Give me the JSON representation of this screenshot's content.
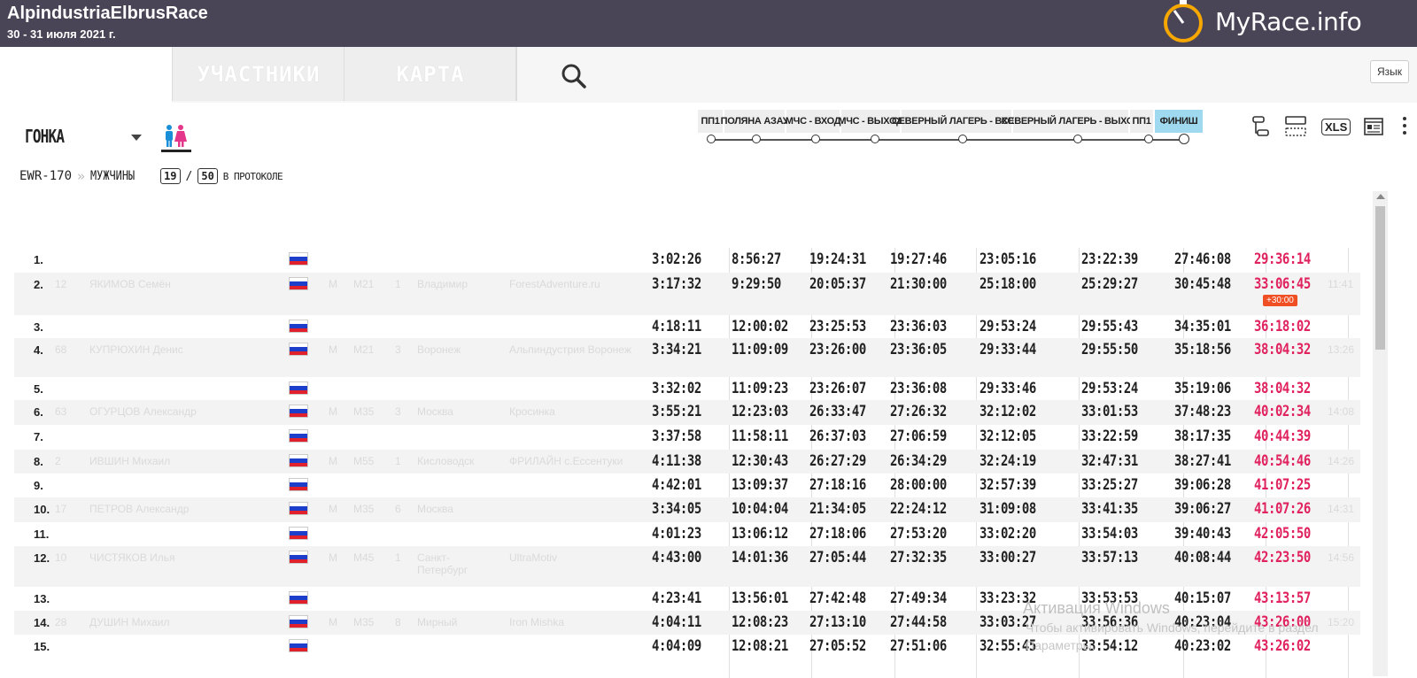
{
  "header": {
    "title": "AlpindustriaElbrusRace",
    "dates": "30 - 31 июля 2021 г.",
    "brand": "MyRace.info"
  },
  "nav": {
    "tabs": [
      {
        "label": "УЧАСТНИКИ"
      },
      {
        "label": "КАРТА"
      }
    ],
    "search_icon": "search-icon",
    "lang_label": "Язык"
  },
  "filters": {
    "race_label": "ГОНКА",
    "gender_icon": "gender-icon"
  },
  "breadcrumb": {
    "distance": "EWR-170",
    "separator": "»",
    "category": "МУЖЧИНЫ",
    "shown": "19",
    "slash": "/",
    "total": "50",
    "suffix": "В ПРОТОКОЛЕ"
  },
  "checkpoints": [
    {
      "label": "ПП1",
      "active": false
    },
    {
      "label": "ПОЛЯНА АЗАУ",
      "active": false
    },
    {
      "label": "МЧС - ВХОД",
      "active": false
    },
    {
      "label": "МЧС - ВЫХОД",
      "active": false
    },
    {
      "label": "СЕВЕРНЫЙ ЛАГЕРЬ - ВХОД",
      "active": false
    },
    {
      "label": "СЕВЕРНЫЙ ЛАГЕРЬ - ВЫХОД",
      "active": false
    },
    {
      "label": "ПП1",
      "active": false
    },
    {
      "label": "ФИНИШ",
      "active": true
    }
  ],
  "tools": {
    "xls_label": "XLS"
  },
  "flag_colors": [
    "#ffffff",
    "#1c3ecb",
    "#e0202a"
  ],
  "results": [
    {
      "place": "1.",
      "bib": "",
      "name": "",
      "sex": "",
      "group": "",
      "gplace": "",
      "city": "",
      "team": "",
      "times": [
        "3:02:26",
        "8:56:27",
        "19:24:31",
        "19:27:46",
        "23:05:16",
        "23:22:39",
        "27:46:08"
      ],
      "finish": "29:36:14",
      "penalty": "",
      "clock": ""
    },
    {
      "place": "2.",
      "bib": "12",
      "name": "ЯКИМОВ Семён",
      "sex": "М",
      "group": "М21",
      "gplace": "1",
      "city": "Владимир",
      "team": "ForestAdventure.ru",
      "times": [
        "3:17:32",
        "9:29:50",
        "20:05:37",
        "21:30:00",
        "25:18:00",
        "25:29:27",
        "30:45:48"
      ],
      "finish": "33:06:45",
      "penalty": "+30:00",
      "clock": "11:41"
    },
    {
      "place": "3.",
      "bib": "",
      "name": "",
      "sex": "",
      "group": "",
      "gplace": "",
      "city": "",
      "team": "",
      "times": [
        "4:18:11",
        "12:00:02",
        "23:25:53",
        "23:36:03",
        "29:53:24",
        "29:55:43",
        "34:35:01"
      ],
      "finish": "36:18:02",
      "penalty": "",
      "clock": ""
    },
    {
      "place": "4.",
      "bib": "68",
      "name": "КУПРЮХИН Денис",
      "sex": "М",
      "group": "М21",
      "gplace": "3",
      "city": "Воронеж",
      "team": "Альпиндустрия Воронеж",
      "times": [
        "3:34:21",
        "11:09:09",
        "23:26:00",
        "23:36:05",
        "29:33:44",
        "29:55:50",
        "35:18:56"
      ],
      "finish": "38:04:32",
      "penalty": "",
      "clock": "13:26"
    },
    {
      "place": "5.",
      "bib": "",
      "name": "",
      "sex": "",
      "group": "",
      "gplace": "",
      "city": "",
      "team": "",
      "times": [
        "3:32:02",
        "11:09:23",
        "23:26:07",
        "23:36:08",
        "29:33:46",
        "29:53:24",
        "35:19:06"
      ],
      "finish": "38:04:32",
      "penalty": "",
      "clock": ""
    },
    {
      "place": "6.",
      "bib": "63",
      "name": "ОГУРЦОВ Александр",
      "sex": "М",
      "group": "М35",
      "gplace": "3",
      "city": "Москва",
      "team": "Кросинка",
      "times": [
        "3:55:21",
        "12:23:03",
        "26:33:47",
        "27:26:32",
        "32:12:02",
        "33:01:53",
        "37:48:23"
      ],
      "finish": "40:02:34",
      "penalty": "",
      "clock": "14:08"
    },
    {
      "place": "7.",
      "bib": "",
      "name": "",
      "sex": "",
      "group": "",
      "gplace": "",
      "city": "",
      "team": "",
      "times": [
        "3:37:58",
        "11:58:11",
        "26:37:03",
        "27:06:59",
        "32:12:05",
        "33:22:59",
        "38:17:35"
      ],
      "finish": "40:44:39",
      "penalty": "",
      "clock": ""
    },
    {
      "place": "8.",
      "bib": "2",
      "name": "ИВШИН Михаил",
      "sex": "М",
      "group": "М55",
      "gplace": "1",
      "city": "Кисловодск",
      "team": "ФРИЛАЙН с.Ессентуки",
      "times": [
        "4:11:38",
        "12:30:43",
        "26:27:29",
        "26:34:29",
        "32:24:19",
        "32:47:31",
        "38:27:41"
      ],
      "finish": "40:54:46",
      "penalty": "",
      "clock": "14:26"
    },
    {
      "place": "9.",
      "bib": "",
      "name": "",
      "sex": "",
      "group": "",
      "gplace": "",
      "city": "",
      "team": "",
      "times": [
        "4:42:01",
        "13:09:37",
        "27:18:16",
        "28:00:00",
        "32:57:39",
        "33:25:27",
        "39:06:28"
      ],
      "finish": "41:07:25",
      "penalty": "",
      "clock": ""
    },
    {
      "place": "10.",
      "bib": "17",
      "name": "ПЕТРОВ Александр",
      "sex": "М",
      "group": "М35",
      "gplace": "6",
      "city": "Москва",
      "team": "",
      "times": [
        "3:34:05",
        "10:04:04",
        "21:34:05",
        "22:24:12",
        "31:09:08",
        "33:41:35",
        "39:06:27"
      ],
      "finish": "41:07:26",
      "penalty": "",
      "clock": "14:31"
    },
    {
      "place": "11.",
      "bib": "",
      "name": "",
      "sex": "",
      "group": "",
      "gplace": "",
      "city": "",
      "team": "",
      "times": [
        "4:01:23",
        "13:06:12",
        "27:18:06",
        "27:53:20",
        "33:02:20",
        "33:54:03",
        "39:40:43"
      ],
      "finish": "42:05:50",
      "penalty": "",
      "clock": ""
    },
    {
      "place": "12.",
      "bib": "10",
      "name": "ЧИСТЯКОВ Илья",
      "sex": "М",
      "group": "М45",
      "gplace": "1",
      "city": "Санкт-Петербург",
      "team": "UltraMotiv",
      "times": [
        "4:43:00",
        "14:01:36",
        "27:05:44",
        "27:32:35",
        "33:00:27",
        "33:57:13",
        "40:08:44"
      ],
      "finish": "42:23:50",
      "penalty": "",
      "clock": "14:56"
    },
    {
      "place": "13.",
      "bib": "",
      "name": "",
      "sex": "",
      "group": "",
      "gplace": "",
      "city": "",
      "team": "",
      "times": [
        "4:23:41",
        "13:56:01",
        "27:42:48",
        "27:49:34",
        "33:23:32",
        "33:53:53",
        "40:15:07"
      ],
      "finish": "43:13:57",
      "penalty": "",
      "clock": ""
    },
    {
      "place": "14.",
      "bib": "28",
      "name": "ДУШИН Михаил",
      "sex": "М",
      "group": "М35",
      "gplace": "8",
      "city": "Мирный",
      "team": "Iron Mishka",
      "times": [
        "4:04:11",
        "12:08:23",
        "27:13:10",
        "27:44:58",
        "33:03:27",
        "33:56:36",
        "40:23:04"
      ],
      "finish": "43:26:00",
      "penalty": "",
      "clock": "15:20"
    },
    {
      "place": "15.",
      "bib": "",
      "name": "",
      "sex": "",
      "group": "",
      "gplace": "",
      "city": "",
      "team": "",
      "times": [
        "4:04:09",
        "12:08:21",
        "27:05:52",
        "27:51:06",
        "32:55:45",
        "33:54:12",
        "40:23:02"
      ],
      "finish": "43:26:02",
      "penalty": "",
      "clock": ""
    }
  ],
  "watermark": {
    "line1": "Активация Windows",
    "line2": "Чтобы активировать Windows, перейдите в раздел",
    "line3": "Параметры."
  }
}
